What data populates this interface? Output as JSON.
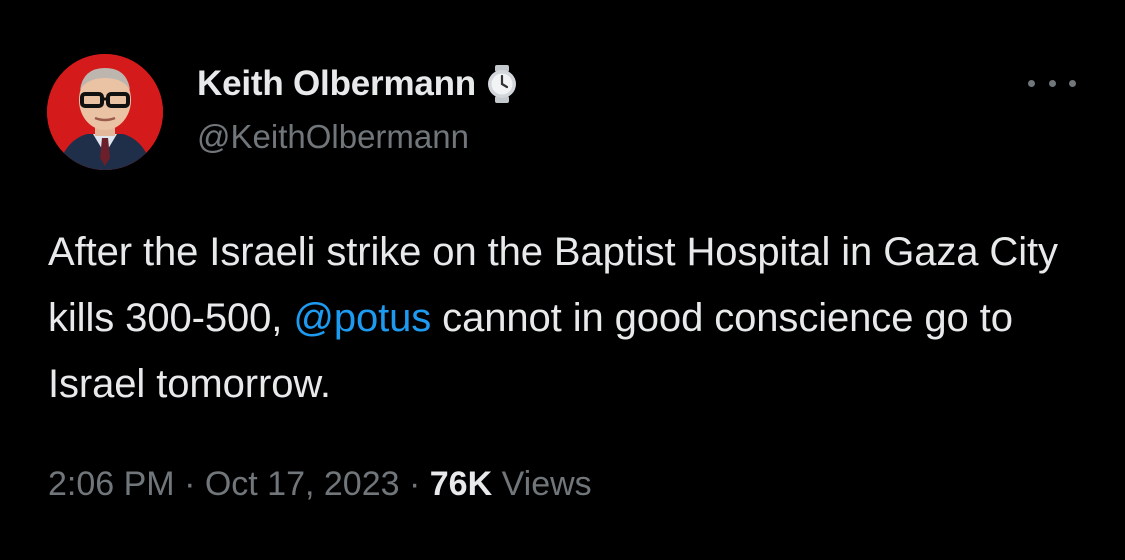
{
  "author": {
    "display_name": "Keith Olbermann",
    "handle": "@KeithOlbermann",
    "avatar_icon": "profile-photo",
    "badge_icon": "watch-icon",
    "avatar_bg": "#d41a1a"
  },
  "tweet": {
    "text_part1": "After the Israeli strike on the Baptist Hospital in Gaza City kills 300-500, ",
    "mention": "@potus",
    "text_part2": " cannot in good conscience go to Israel tomorrow.",
    "time": "2:06 PM",
    "separator": " · ",
    "date": "Oct 17, 2023",
    "views_count": "76K",
    "views_label": " Views"
  },
  "menu": {
    "more_icon": "more-icon"
  },
  "colors": {
    "background": "#000000",
    "text": "#e7e9ea",
    "secondary": "#71767b",
    "link": "#1d9bf0"
  }
}
